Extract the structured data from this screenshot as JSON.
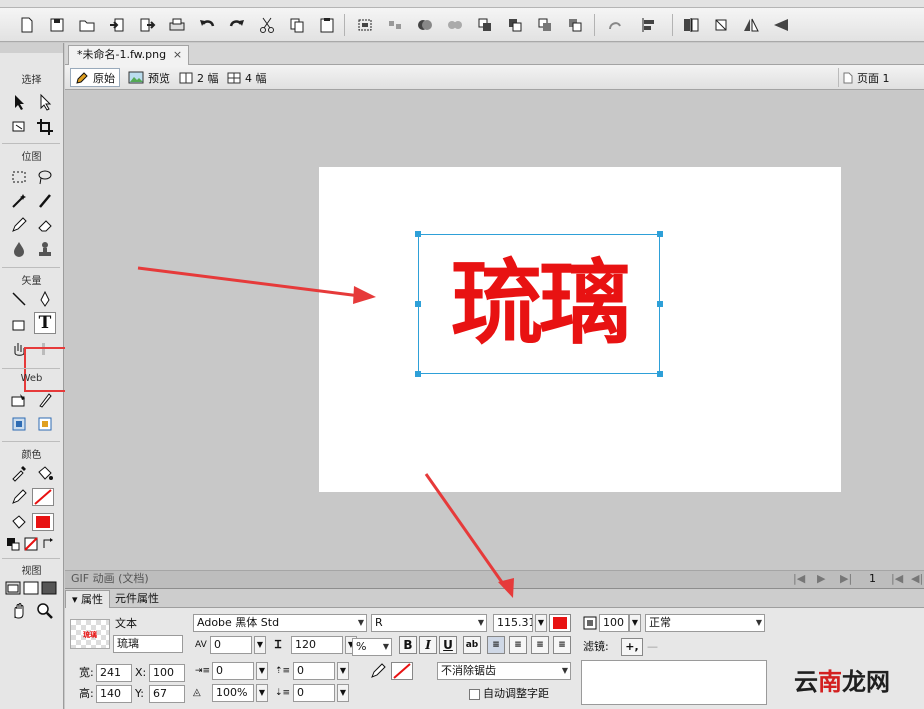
{
  "document": {
    "tab_title": "*未命名-1.fw.png",
    "close_symbol": "×",
    "canvas_text": "琉璃",
    "status_text": "GIF 动画 (文档)",
    "page_number": "1"
  },
  "view_bar": {
    "original": "原始",
    "preview": "预览",
    "two_up": "2 幅",
    "four_up": "4 幅",
    "page": "页面 1"
  },
  "tools": {
    "select": "选择",
    "bitmap": "位图",
    "vector": "矢量",
    "web": "Web",
    "colors": "颜色",
    "view": "视图",
    "text_tool": "T"
  },
  "properties": {
    "tab_props": "属性",
    "tab_symbol": "元件属性",
    "object_type": "文本",
    "object_name": "琉璃",
    "thumb_text": "琉璃",
    "font_family": "Adobe 黑体 Std",
    "font_style": "R",
    "font_size": "115.31",
    "kerning": "0",
    "leading": "120",
    "leading_unit": "%",
    "bold": "B",
    "italic": "I",
    "underline": "U",
    "indent": "0",
    "space_before": "0",
    "horiz_scale": "100%",
    "space_after": "0",
    "baseline_shift": "0",
    "antialias": "不消除锯齿",
    "auto_kern": "自动调整字距",
    "opacity": "100",
    "blend_mode": "正常",
    "filters_label": "滤镜:",
    "filter_add": "+,",
    "filter_remove": "—",
    "width_label": "宽:",
    "width": "241",
    "height_label": "高:",
    "height": "140",
    "x_label": "X:",
    "x": "100",
    "y_label": "Y:",
    "y": "67"
  },
  "colors": {
    "text_fill": "#e81212",
    "selection": "#2ea0d8",
    "annotation": "#e63a3a"
  },
  "watermark": {
    "part1": "云",
    "part2": "南",
    "part3": "龙网"
  }
}
